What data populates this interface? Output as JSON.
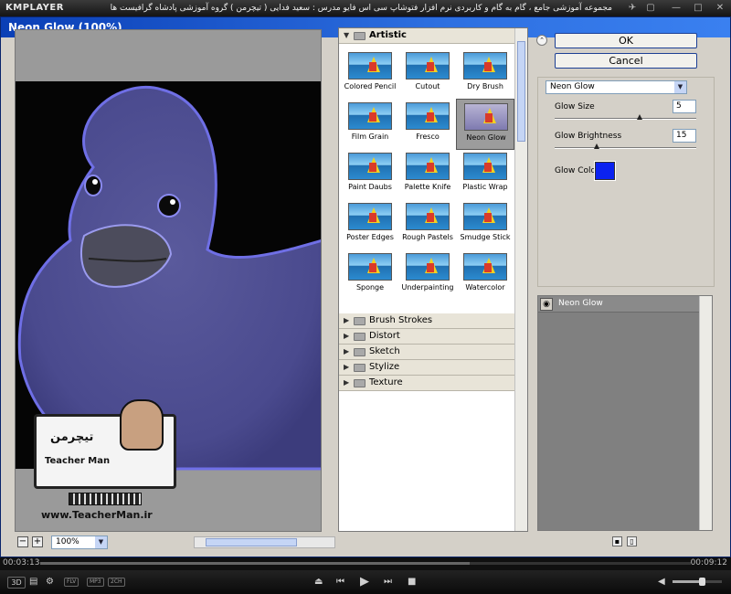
{
  "player": {
    "logo": "KMPLAYER",
    "video_title": "مجموعه آموزشی جامع ، گام به گام و کاربردی نرم افزار فتوشاپ سی اس فایو   مدرس : سعید فدایی ( تیچرمن ) گروه آموزشی پادشاه گرافیست ها",
    "time_current": "00:03:13",
    "time_total": "00:09:12",
    "progress": 0.66,
    "volume": 0.6,
    "badges": [
      "FLV",
      "MP3",
      "2CH"
    ],
    "three_d_label": "3D"
  },
  "dialog": {
    "title": "Neon Glow (100%)",
    "zoom": "100%",
    "ok_label": "OK",
    "cancel_label": "Cancel"
  },
  "gallery": {
    "open_category": "Artistic",
    "filters": [
      {
        "label": "Colored Pencil"
      },
      {
        "label": "Cutout"
      },
      {
        "label": "Dry Brush"
      },
      {
        "label": "Film Grain"
      },
      {
        "label": "Fresco"
      },
      {
        "label": "Neon Glow"
      },
      {
        "label": "Paint Daubs"
      },
      {
        "label": "Palette Knife"
      },
      {
        "label": "Plastic Wrap"
      },
      {
        "label": "Poster Edges"
      },
      {
        "label": "Rough Pastels"
      },
      {
        "label": "Smudge Stick"
      },
      {
        "label": "Sponge"
      },
      {
        "label": "Underpainting"
      },
      {
        "label": "Watercolor"
      }
    ],
    "selected_filter": "Neon Glow",
    "collapsed_categories": [
      "Brush Strokes",
      "Distort",
      "Sketch",
      "Stylize",
      "Texture"
    ]
  },
  "settings": {
    "filter_dropdown": "Neon Glow",
    "glow_size_label": "Glow Size",
    "glow_size": "5",
    "glow_brightness_label": "Glow Brightness",
    "glow_brightness": "15",
    "glow_color_label": "Glow Color",
    "glow_color": "#0b22f0"
  },
  "layers": {
    "layer_name": "Neon Glow"
  },
  "watermark": {
    "brand_text": "Teacher Man",
    "brand_persian": "تیچرمن",
    "url": "www.TeacherMan.ir"
  }
}
